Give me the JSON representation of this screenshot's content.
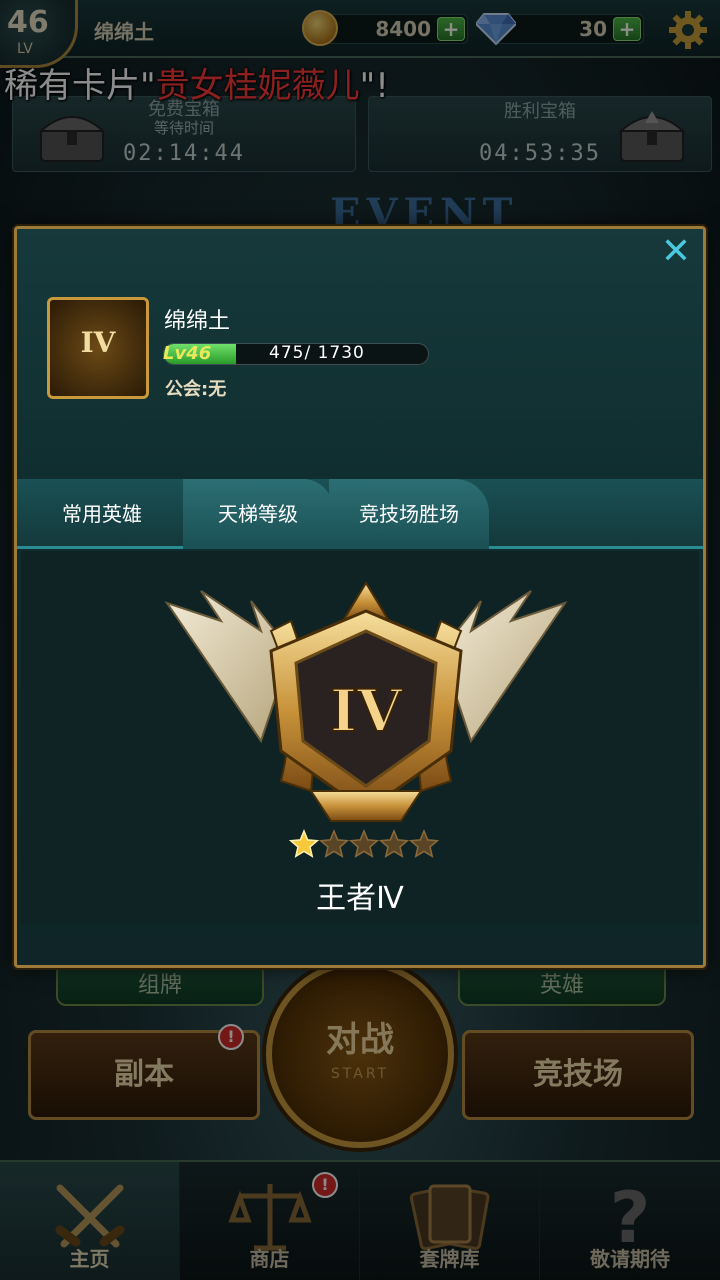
{
  "player": {
    "level": "46",
    "level_prefix": "LV",
    "name": "绵绵土"
  },
  "resources": {
    "gold": "8400",
    "gems": "30",
    "plus_label": "+"
  },
  "notice": {
    "prefix": "稀有卡片\"",
    "highlight": "贵女桂妮薇儿",
    "suffix": "\"!"
  },
  "chests": {
    "free": {
      "title": "免费宝箱",
      "subtitle": "等待时间",
      "time": "02:14:44"
    },
    "win": {
      "title": "胜利宝箱",
      "time": "04:53:35"
    }
  },
  "event_banner": "EVENT",
  "profile_modal": {
    "close_label": "✕",
    "avatar_rank": "IV",
    "name": "绵绵土",
    "level_label": "Lv46",
    "exp_current": 475,
    "exp_max": 1730,
    "exp_text": "475/ 1730",
    "guild": "公会:无",
    "tabs": [
      "常用英雄",
      "天梯等级",
      "竞技场胜场"
    ],
    "active_tab": 1,
    "rank_numeral": "IV",
    "rank_stars": 1,
    "rank_stars_total": 5,
    "rank_title": "王者Ⅳ"
  },
  "main_buttons": {
    "deck": "组牌",
    "hero": "英雄",
    "dungeon": "副本",
    "arena": "竞技场",
    "battle": "对战",
    "battle_sub": "START",
    "alert": "!"
  },
  "navbar": {
    "items": [
      "主页",
      "商店",
      "套牌库",
      "敬请期待"
    ],
    "active": 0
  },
  "colors": {
    "gold_frame": "#9c7a3a",
    "tab_accent": "#2b8b93",
    "highlight_red": "#ff3b3b",
    "exp_green": "#4fbb4a"
  }
}
